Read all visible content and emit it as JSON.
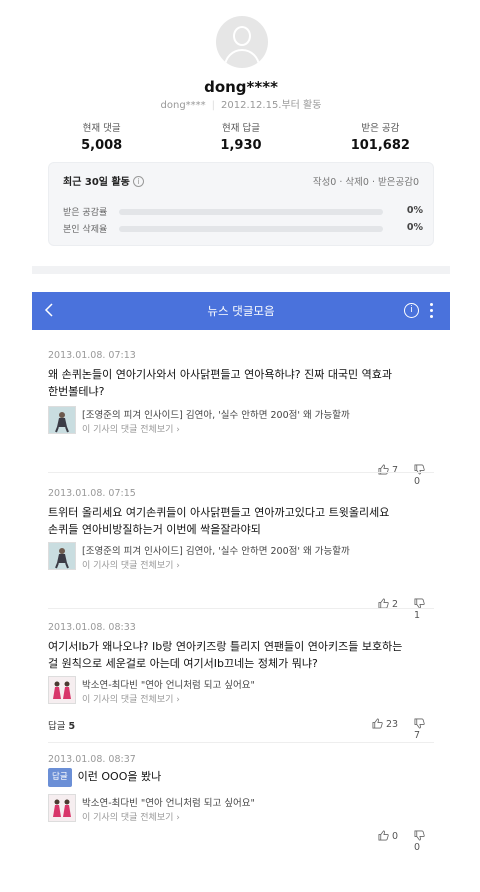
{
  "profile": {
    "nickname": "dong****",
    "id": "dong****",
    "since": "2012.12.15.부터 활동",
    "stats": [
      {
        "label": "현재 댓글",
        "value": "5,008"
      },
      {
        "label": "현재 답글",
        "value": "1,930"
      },
      {
        "label": "받은 공감",
        "value": "101,682"
      }
    ],
    "activity": {
      "title": "최근 30일 활동",
      "info_icon": "i",
      "counts": "작성0 · 삭제0 · 받은공감0",
      "rows": [
        {
          "label": "받은 공감률",
          "percent": "0%",
          "value": 0
        },
        {
          "label": "본인 삭제율",
          "percent": "0%",
          "value": 0
        }
      ]
    }
  },
  "header": {
    "title": "뉴스 댓글모음",
    "info_icon": "i"
  },
  "comments": [
    {
      "date": "2013.01.08. 07:13",
      "text_lines": [
        "왜 손퀴논들이 연아기사와서 아사닭편들고 연아욕하냐? 진짜 대국민 역효과",
        "한번볼테냐?"
      ],
      "article_title": "[조영준의 피겨 인사이드] 김연아, '실수 안하면 200점' 왜 가능할까",
      "article_link": "이 기사의 댓글 전체보기 ›",
      "replies_label": "",
      "replies_count": "",
      "likes": "7",
      "dislikes": "0"
    },
    {
      "date": "2013.01.08. 07:15",
      "text_lines": [
        "트위터 올리세요 여기손퀴들이 아사닭편들고 연아까고있다고 트윗올리세요",
        "손퀴들 연아비방질하는거 이번에 싹을잘라야되"
      ],
      "article_title": "[조영준의 피겨 인사이드] 김연아, '실수 안하면 200점' 왜 가능할까",
      "article_link": "이 기사의 댓글 전체보기 ›",
      "replies_label": "",
      "replies_count": "",
      "likes": "2",
      "dislikes": "1"
    },
    {
      "date": "2013.01.08. 08:33",
      "text_lines": [
        "여기서Ib가 왜나오냐? Ib랑 연아키즈랑 틀리지 연팬들이 연아키즈들 보호하는",
        "걸 원칙으로 세운걸로 아는데 여기서Ib끄네는 정체가 뭐냐?"
      ],
      "article_title": "박소연-최다빈 \"연아 언니처럼 되고 싶어요\"",
      "article_link": "이 기사의 댓글 전체보기 ›",
      "replies_label": "답글",
      "replies_count": "5",
      "likes": "23",
      "dislikes": "7"
    },
    {
      "date": "2013.01.08. 08:37",
      "reply_tag": "답글",
      "text_lines": [
        "이런 OOO을 봤나"
      ],
      "article_title": "박소연-최다빈 \"연아 언니처럼 되고 싶어요\"",
      "article_link": "이 기사의 댓글 전체보기 ›",
      "replies_label": "",
      "replies_count": "",
      "likes": "0",
      "dislikes": "0"
    }
  ],
  "colors": {
    "accent": "#4a72dc",
    "bar_fill": "#4a6ee0"
  }
}
